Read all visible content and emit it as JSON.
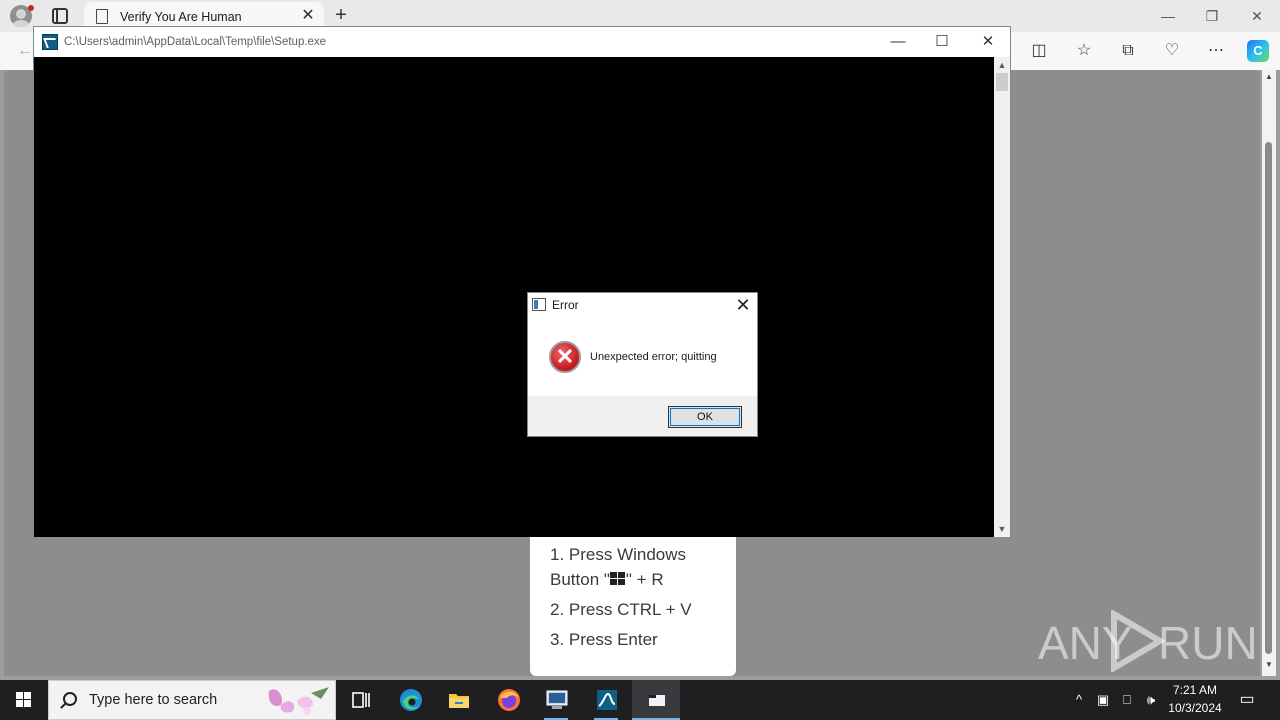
{
  "browser": {
    "tab_title": "Verify You Are Human",
    "tab_close": "✕",
    "new_tab": "+"
  },
  "console": {
    "title": "C:\\Users\\admin\\AppData\\Local\\Temp\\file\\Setup.exe"
  },
  "error_dialog": {
    "title": "Error",
    "message": "Unexpected error; quitting",
    "ok_label": "OK"
  },
  "page": {
    "steps": [
      "1. Press Windows",
      "Button \"",
      "\" + R",
      "2. Press CTRL + V",
      "3. Press Enter"
    ]
  },
  "watermark": {
    "left": "ANY",
    "right": "RUN"
  },
  "taskbar": {
    "search_placeholder": "Type here to search",
    "time": "7:21 AM",
    "date": "10/3/2024"
  },
  "colors": {
    "console_bg": "#000000",
    "taskbar_bg": "#1f1f22",
    "error_red": "#c3141a",
    "accent": "#0078d7"
  },
  "icons": {
    "browser": [
      "profile-icon",
      "tab-actions-icon",
      "page-icon",
      "close-icon",
      "plus-icon",
      "back-icon",
      "split-screen-icon",
      "favorites-icon",
      "collections-icon",
      "browser-essentials-icon",
      "more-icon",
      "copilot-icon"
    ],
    "taskbar": [
      "windows-icon",
      "search-icon",
      "task-view-icon",
      "edge-icon",
      "file-explorer-icon",
      "firefox-icon",
      "network-app-icon",
      "setup-app-icon",
      "console-app-icon"
    ]
  }
}
